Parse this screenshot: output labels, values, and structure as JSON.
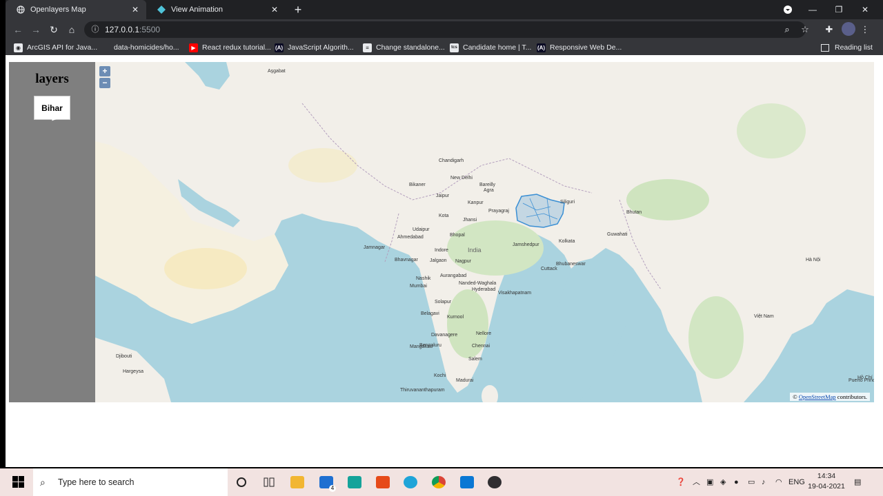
{
  "browser": {
    "tabs": [
      {
        "title": "Openlayers Map",
        "active": true,
        "icon": "globe-icon"
      },
      {
        "title": "View Animation",
        "active": false,
        "icon": "openlayers-icon"
      }
    ],
    "url_host": "127.0.0.1",
    "url_port": ":5500",
    "bookmarks": [
      {
        "label": "ArcGIS API for Java...",
        "icon": "arcgis-icon",
        "color": "#e8eaed"
      },
      {
        "label": "data-homicides/ho...",
        "icon": "github-icon",
        "color": "#35363a"
      },
      {
        "label": "React redux tutorial...",
        "icon": "youtube-icon",
        "color": "#ff0000"
      },
      {
        "label": "JavaScript Algorith...",
        "icon": "freecodecamp-icon",
        "color": "#0a0a23"
      },
      {
        "label": "Change standalone...",
        "icon": "stackexchange-icon",
        "color": "#e8eaed"
      },
      {
        "label": "Candidate home | T...",
        "icon": "tcs-icon",
        "color": "#e8eaed"
      },
      {
        "label": "Responsive Web De...",
        "icon": "freecodecamp-icon",
        "color": "#0a0a23"
      }
    ],
    "reading_list": "Reading list"
  },
  "page": {
    "sidebar_title": "layers",
    "layer_button": "Bihar",
    "attribution_prefix": "© ",
    "attribution_link": "OpenStreetMap",
    "attribution_suffix": " contributors.",
    "zoom_in": "+",
    "zoom_out": "−"
  },
  "map": {
    "labels": [
      "New Delhi",
      "India",
      "Kolkata",
      "Mumbai",
      "Chennai",
      "Bengaluru",
      "Prayagraj",
      "Kanpur",
      "Jaipur",
      "Agra",
      "Chandigarh",
      "Bhopal",
      "Nagpur",
      "Hyderabad",
      "Ahmedabad",
      "Visakhapatnam",
      "Siliguri",
      "Jamshedpur",
      "Cuttack",
      "Udaipur",
      "Bikaner",
      "Kota",
      "Jhansi",
      "Indore",
      "Jalgaon",
      "Aurangabad",
      "Nashik",
      "Solapur",
      "Belagavi",
      "Kurnool",
      "Nellore",
      "Davanagere",
      "Mangaluru",
      "Kochi",
      "Madurai",
      "Salem",
      "Thiruvananthapuram",
      "Bareilly",
      "Bhavnagar",
      "Jamnagar",
      "Nanded-Waghala",
      "Bhubaneswar",
      "Puerto Princes",
      "Hargeysa",
      "Djibouti",
      "Aşgabat",
      "Hồ Chí Minh",
      "Việt Nam",
      "Hà Nội",
      "Guwahati",
      "Bhutan"
    ],
    "highlight_layer": "Bihar",
    "highlight_color": "#3a8fd4"
  },
  "taskbar": {
    "search_placeholder": "Type here to search",
    "apps": [
      "cortana-icon",
      "task-view-icon",
      "file-explorer-icon",
      "mail-icon",
      "sway-icon",
      "office-icon",
      "edge-icon",
      "chrome-icon",
      "vscode-icon",
      "obs-icon"
    ],
    "mail_badge": "4",
    "language": "ENG",
    "time": "14:34",
    "date": "19-04-2021"
  }
}
